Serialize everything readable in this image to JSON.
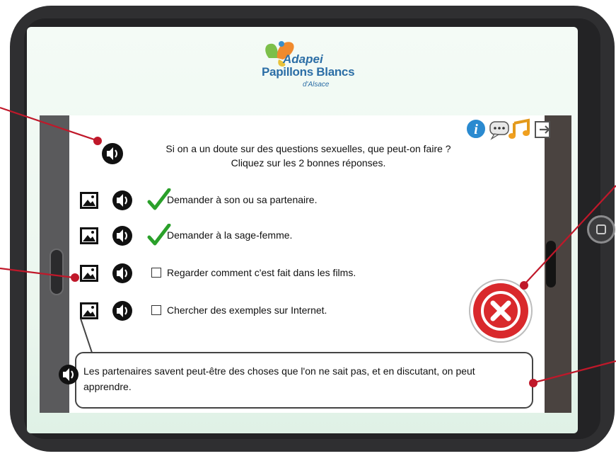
{
  "logo": {
    "line1": "Adapei",
    "line2": "Papillons Blancs",
    "line3": "d'Alsace"
  },
  "toolbar": {
    "icons": [
      "info-icon",
      "comment-icon",
      "music-icon",
      "exit-icon"
    ],
    "info_color": "#2a8ad0",
    "music_color": "#f0a020"
  },
  "question": {
    "line1": "Si on a un doute sur des questions sexuelles, que peut-on faire ?",
    "line2": "Cliquez sur les 2 bonnes réponses."
  },
  "answers": [
    {
      "label": "Demander à son ou sa partenaire.",
      "checked": true
    },
    {
      "label": "Demander à la sage-femme.",
      "checked": true
    },
    {
      "label": "Regarder comment c'est fait dans les films.",
      "checked": false
    },
    {
      "label": "Chercher des exemples sur Internet.",
      "checked": false
    }
  ],
  "feedback": {
    "text": "Les partenaires savent peut-être des choses que l'on ne sait pas, et en discutant, on peut apprendre."
  },
  "colors": {
    "annotation": "#c0182a",
    "check": "#2aa02a",
    "close_red": "#d9292c"
  }
}
